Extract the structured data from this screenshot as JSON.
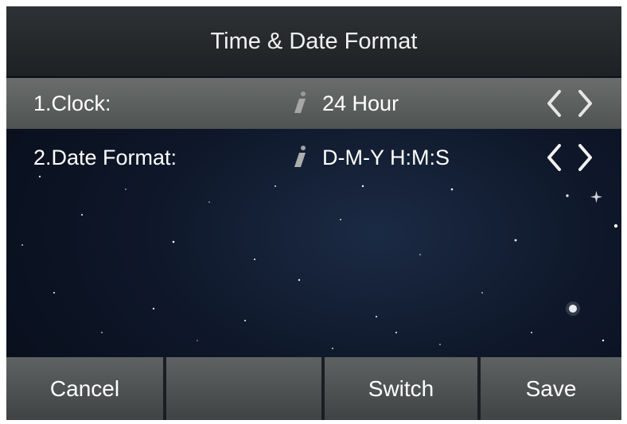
{
  "header": {
    "title": "Time & Date Format"
  },
  "settings": [
    {
      "label": "1.Clock:",
      "value": "24 Hour",
      "selected": true
    },
    {
      "label": "2.Date Format:",
      "value": "D-M-Y H:M:S",
      "selected": false
    }
  ],
  "softkeys": [
    {
      "label": "Cancel"
    },
    {
      "label": ""
    },
    {
      "label": "Switch"
    },
    {
      "label": "Save"
    }
  ],
  "icons": {
    "info": "info-icon",
    "prev": "chevron-left-icon",
    "next": "chevron-right-icon"
  },
  "colors": {
    "title_bar": "#2e3235",
    "selected_row": "#5f6362",
    "softkey": "#4e5252",
    "background": "#0e1729"
  }
}
